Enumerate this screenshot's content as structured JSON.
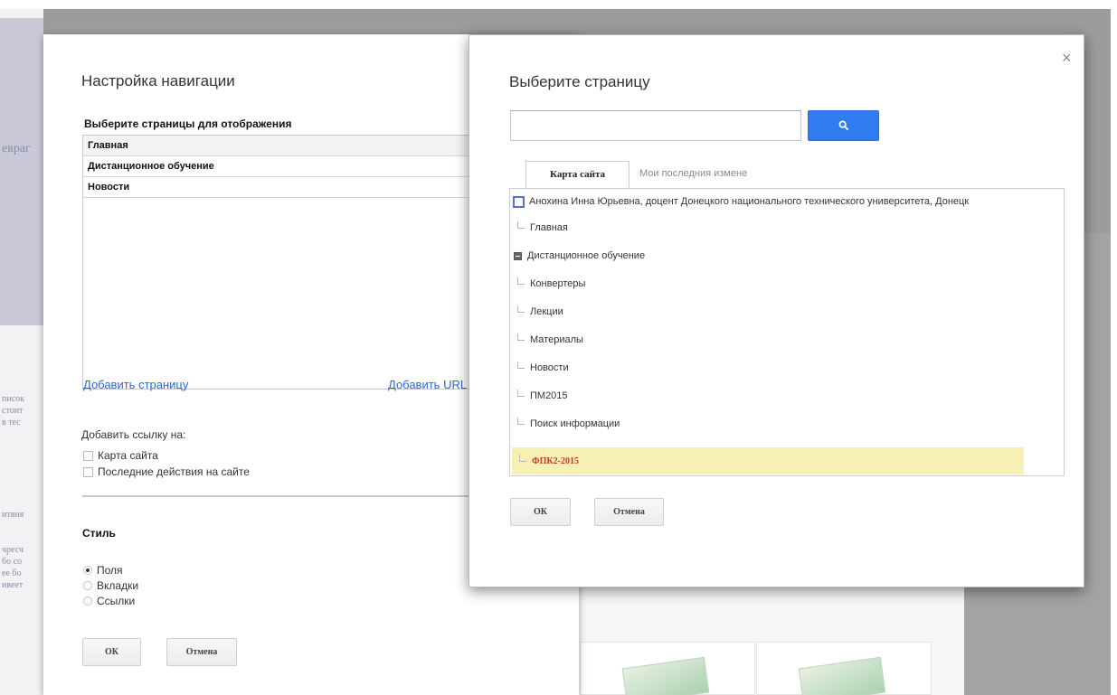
{
  "background": {
    "ghost_fragments": [
      "евраг",
      "писок",
      "стоит",
      "в тес",
      "итвня",
      "чресч",
      "бо со",
      "ее бо",
      "ивеет"
    ]
  },
  "nav_dialog": {
    "title": "Настройка навигации",
    "pages_label": "Выберите страницы для отображения",
    "pages": [
      "Главная",
      "Дистанционное обучение",
      "Новости"
    ],
    "add_page_link": "Добавить страницу",
    "add_url_link": "Добавить URL",
    "add_link_label": "Добавить ссылку на:",
    "checkboxes": [
      {
        "label": "Карта сайта",
        "checked": false
      },
      {
        "label": "Последние действия на сайте",
        "checked": false
      }
    ],
    "style_label": "Стиль",
    "style_options": [
      {
        "label": "Поля",
        "selected": true
      },
      {
        "label": "Вкладки",
        "selected": false
      },
      {
        "label": "Ссылки",
        "selected": false
      }
    ],
    "ok_label": "ОК",
    "cancel_label": "Отмена"
  },
  "picker_dialog": {
    "title": "Выберите страницу",
    "close_glyph": "×",
    "search": {
      "value": "",
      "placeholder": ""
    },
    "tabs": [
      {
        "label": "Карта сайта",
        "active": true
      },
      {
        "label": "Мои последния измене",
        "active": false
      }
    ],
    "tree": [
      {
        "label": "Анохина Инна Юрьевна, доцент Донецкого национального технического университета, Донецк",
        "kind": "root"
      },
      {
        "label": "Главная",
        "kind": "leaf"
      },
      {
        "label": "Дистанционное обучение",
        "kind": "expanded"
      },
      {
        "label": "Конвертеры",
        "kind": "leaf"
      },
      {
        "label": "Лекции",
        "kind": "leaf"
      },
      {
        "label": "Материалы",
        "kind": "leaf"
      },
      {
        "label": "Новости",
        "kind": "leaf"
      },
      {
        "label": "ПМ2015",
        "kind": "leaf"
      },
      {
        "label": "Поиск информации",
        "kind": "leaf"
      },
      {
        "label": "ФПК2-2015",
        "kind": "selected"
      }
    ],
    "ok_label": "ОК",
    "cancel_label": "Отмена"
  },
  "colors": {
    "accent_blue": "#2e7cf0",
    "link_blue": "#3366cc",
    "selection_yellow": "#f6f0b4",
    "selected_text": "#c0392b"
  }
}
